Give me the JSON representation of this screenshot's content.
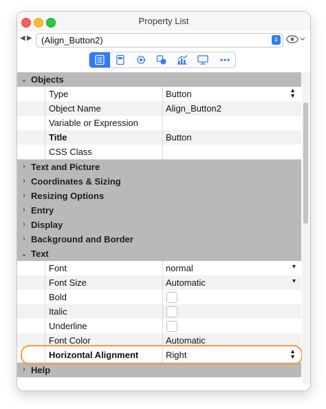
{
  "window": {
    "title": "Property List"
  },
  "nav": {
    "back_icon": "◀",
    "forward_icon": "▶",
    "selected_object": "(Align_Button2)"
  },
  "toolbar": {
    "tabs": [
      "list-icon",
      "form-icon",
      "gear-icon",
      "shapes-icon",
      "chart-icon",
      "monitor-icon",
      "more-icon"
    ],
    "accent": "#3478f6"
  },
  "sections": {
    "objects": "Objects",
    "text_and_picture": "Text and Picture",
    "coordinates": "Coordinates & Sizing",
    "resizing": "Resizing Options",
    "entry": "Entry",
    "display": "Display",
    "background": "Background and Border",
    "text": "Text",
    "help": "Help"
  },
  "objects_props": {
    "type": {
      "label": "Type",
      "value": "Button"
    },
    "object_name": {
      "label": "Object Name",
      "value": "Align_Button2"
    },
    "variable": {
      "label": "Variable or Expression",
      "value": ""
    },
    "title": {
      "label": "Title",
      "value": "Button"
    },
    "css_class": {
      "label": "CSS Class",
      "value": ""
    }
  },
  "text_props": {
    "font": {
      "label": "Font",
      "value": "normal"
    },
    "font_size": {
      "label": "Font Size",
      "value": "Automatic"
    },
    "bold": {
      "label": "Bold"
    },
    "italic": {
      "label": "Italic"
    },
    "underline": {
      "label": "Underline"
    },
    "font_color": {
      "label": "Font Color",
      "value": "Automatic"
    },
    "horizontal_alignment": {
      "label": "Horizontal Alignment",
      "value": "Right"
    }
  },
  "highlight_color": "#f2a03d"
}
